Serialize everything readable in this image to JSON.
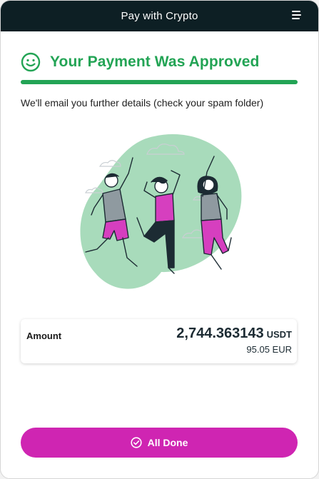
{
  "header": {
    "title": "Pay with Crypto",
    "menu_icon": "hamburger-menu-icon"
  },
  "status": {
    "icon": "smile-icon",
    "title": "Your Payment Was Approved",
    "progress_fraction": 1.0,
    "message": "We'll email you further details (check your spam folder)"
  },
  "illustration": {
    "name": "celebrating-people-illustration"
  },
  "amount": {
    "label": "Amount",
    "crypto_value": "2,744.363143",
    "crypto_currency": "USDT",
    "fiat": "95.05 EUR"
  },
  "actions": {
    "done_label": "All Done",
    "done_icon": "check-circle-icon"
  },
  "colors": {
    "header_bg": "#0d1f24",
    "success_green": "#23a455",
    "button_magenta": "#cf25b2",
    "blob_green": "#a8dbbb"
  }
}
